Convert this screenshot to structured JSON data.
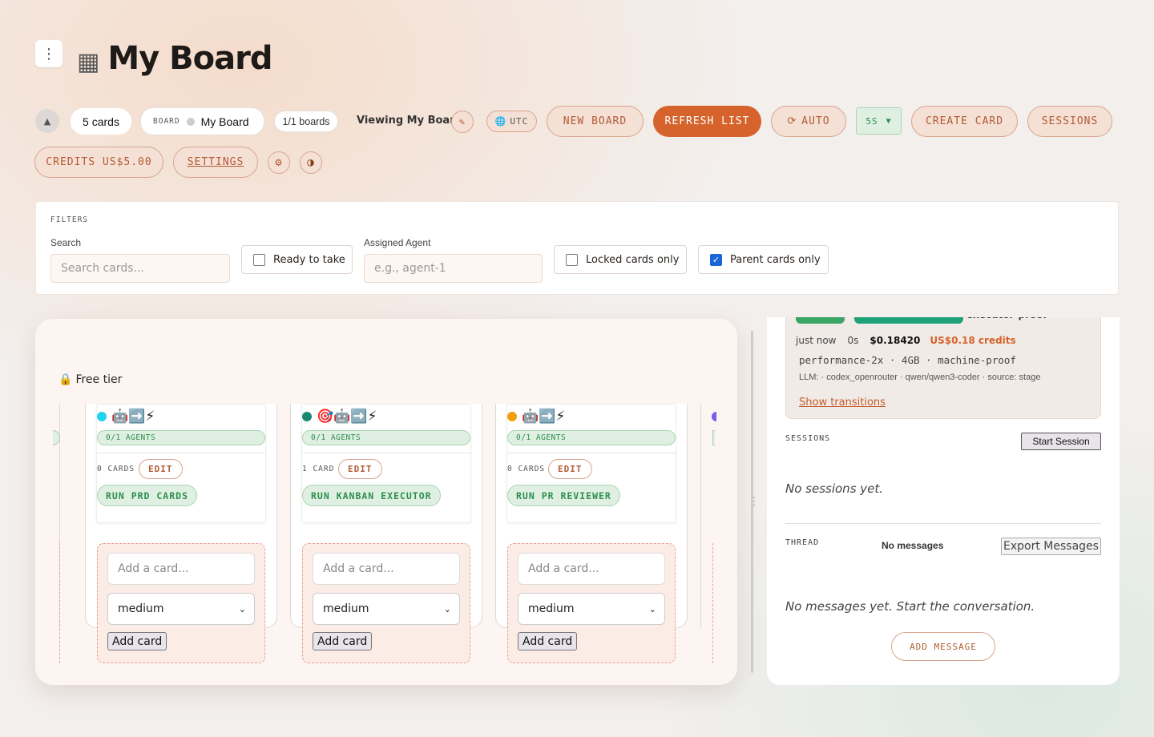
{
  "header": {
    "title": "My Board",
    "menu_icon": "vertical-dots-icon",
    "board_icon": "grid-icon"
  },
  "toolbar": {
    "cards_count": "5 cards",
    "board_label": "BOARD",
    "board_name": "My Board",
    "boards_count": "1/1 boards",
    "viewing": "Viewing My Board",
    "timezone": "UTC",
    "new_board": "NEW BOARD",
    "refresh_list": "REFRESH LIST",
    "auto": "AUTO",
    "interval": "5S",
    "create_card": "CREATE CARD",
    "sessions": "SESSIONS",
    "credits": "CREDITS US$5.00",
    "settings": "SETTINGS"
  },
  "filters": {
    "heading": "FILTERS",
    "search_label": "Search",
    "search_placeholder": "Search cards...",
    "ready_label": "Ready to take",
    "ready_checked": false,
    "agent_label": "Assigned Agent",
    "agent_placeholder": "e.g., agent-1",
    "locked_label": "Locked cards only",
    "locked_checked": false,
    "parent_label": "Parent cards only",
    "parent_checked": true
  },
  "board": {
    "tier": "Free tier",
    "columns": [
      {
        "dot_color": "#22d3ee",
        "agents": "0/1 AGENTS",
        "count": "0 CARDS",
        "edit": "EDIT",
        "run": "RUN PRD CARDS",
        "icons": "🤖➡️⚡"
      },
      {
        "dot_color": "#1a8a6e",
        "agents": "0/1 AGENTS",
        "count": "1 CARD",
        "edit": "EDIT",
        "run": "RUN KANBAN EXECUTOR",
        "icons": "🎯🤖➡️⚡"
      },
      {
        "dot_color": "#f59e0b",
        "agents": "0/1 AGENTS",
        "count": "0 CARDS",
        "edit": "EDIT",
        "run": "RUN PR REVIEWER",
        "icons": "🤖➡️⚡"
      }
    ],
    "add_placeholder": "Add a card...",
    "priority": "medium",
    "add_button": "Add card"
  },
  "side": {
    "partial_label": "executor-proof",
    "time": "just now",
    "duration": "0s",
    "cost": "$0.18420",
    "credits": "US$0.18 credits",
    "machine": "performance-2x · 4GB · machine-proof",
    "llm": "LLM: · codex_openrouter · qwen/qwen3-coder · source: stage",
    "show_transitions": "Show transitions",
    "sessions_heading": "SESSIONS",
    "start_session": "Start Session",
    "no_sessions": "No sessions yet.",
    "thread_heading": "THREAD",
    "thread_status": "No messages",
    "export": "Export Messages",
    "no_messages": "No messages yet. Start the conversation.",
    "add_message": "ADD MESSAGE"
  },
  "colors": {
    "accent": "#d6632c",
    "success": "#2d8e4d",
    "bg": "#f3efed"
  }
}
